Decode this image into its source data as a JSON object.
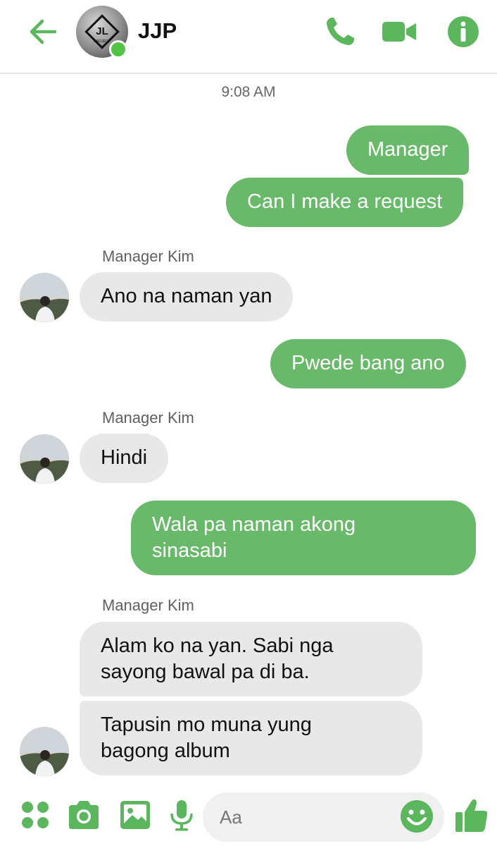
{
  "header": {
    "title": "JJP",
    "avatar_text": "JL",
    "avatar_subtext": "PROJECT"
  },
  "accent_color": "#69b96a",
  "icons": [
    "back-arrow-icon",
    "phone-icon",
    "video-camera-icon",
    "info-icon",
    "apps-grid-icon",
    "camera-icon",
    "image-icon",
    "microphone-icon",
    "emoji-icon",
    "thumbs-up-icon"
  ],
  "timestamp": "9:08 AM",
  "messages": [
    {
      "from": "me",
      "text": "Manager"
    },
    {
      "from": "me",
      "text": "Can I make a request"
    },
    {
      "from": "them",
      "sender": "Manager Kim",
      "text": "Ano na naman yan"
    },
    {
      "from": "me",
      "text": "Pwede bang ano"
    },
    {
      "from": "them",
      "sender": "Manager Kim",
      "text": "Hindi"
    },
    {
      "from": "me",
      "text_line1": "Wala pa naman akong",
      "text_line2": "sinasabi"
    },
    {
      "from": "them",
      "sender": "Manager Kim",
      "text_line1": "Alam ko na yan. Sabi nga",
      "text_line2": "sayong bawal pa di ba."
    },
    {
      "from": "them",
      "text_line1": "Tapusin mo muna yung",
      "text_line2": "bagong album"
    }
  ],
  "composer": {
    "placeholder": "Aa"
  }
}
